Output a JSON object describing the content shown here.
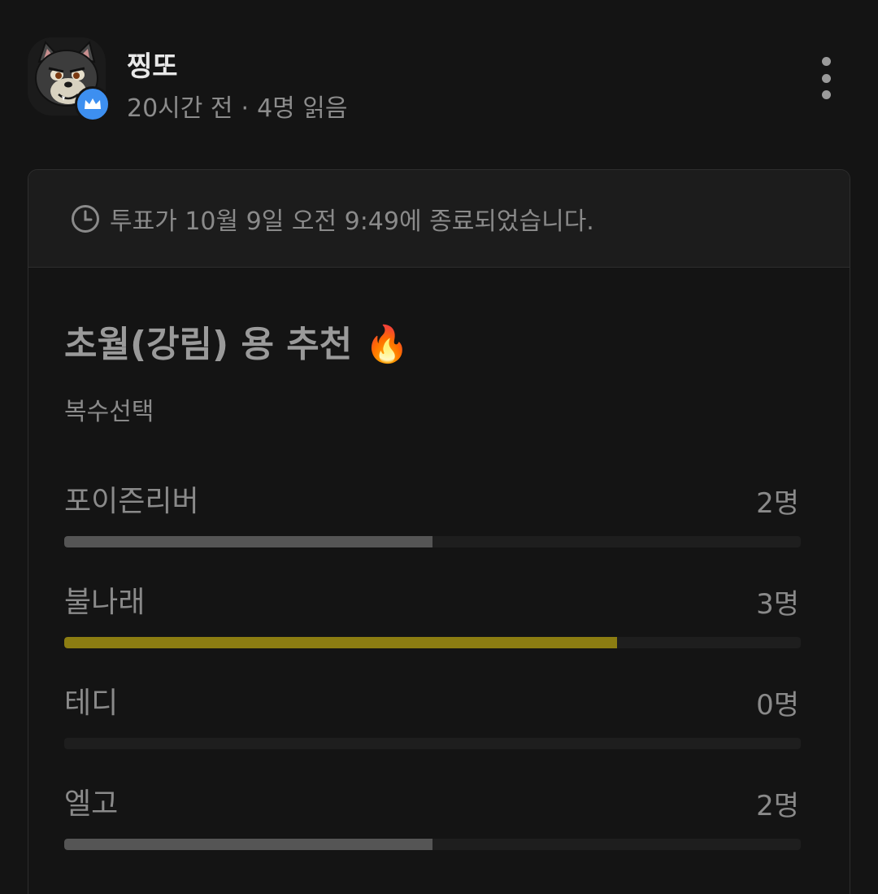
{
  "post_header": {
    "author": "찡또",
    "time_ago": "20시간 전",
    "separator": "·",
    "read_count": "4명 읽음",
    "badge_icon": "crown-icon",
    "menu_icon": "more-vertical-icon"
  },
  "poll": {
    "status_icon": "clock-icon",
    "status": "투표가 10월 9일 오전 9:49에 종료되었습니다.",
    "title": "초월(강림) 용 추천 🔥",
    "type": "복수선택",
    "accent_color": "#8c7d12",
    "bar_color": "#555555",
    "options": [
      {
        "label": "포이즌리버",
        "count": "2명",
        "fraction": 0.5
      },
      {
        "label": "불나래",
        "count": "3명",
        "fraction": 0.75
      },
      {
        "label": "테디",
        "count": "0명",
        "fraction": 0.0
      },
      {
        "label": "엘고",
        "count": "2명",
        "fraction": 0.5
      }
    ]
  }
}
